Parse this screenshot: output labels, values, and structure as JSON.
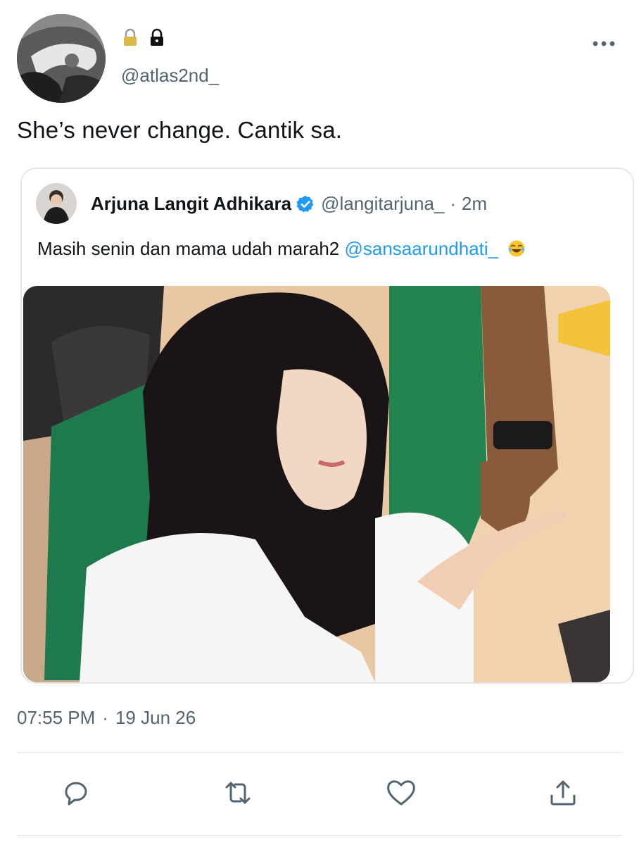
{
  "tweet": {
    "handle": "@atlas2nd_",
    "text": "She’s never change. Cantik sa.",
    "timestamp_time": "07:55 PM",
    "timestamp_sep": "·",
    "timestamp_date": "19 Jun 26"
  },
  "quote": {
    "name": "Arjuna Langit Adhikara",
    "handle": "@langitarjuna_",
    "separator": "·",
    "time": "2m",
    "text": "Masih senin dan mama udah marah2",
    "mention": "@sansaarundhati_",
    "emoji": "face-with-tears-of-joy-icon"
  },
  "icons": {
    "header": [
      "lock-icon",
      "lock-icon",
      "more-icon"
    ],
    "actions": [
      "reply-icon",
      "retweet-icon",
      "like-icon",
      "share-icon"
    ]
  },
  "colors": {
    "accent": "#1d9bf0",
    "secondary_text": "#536471",
    "primary_text": "#0f1419",
    "border": "#e3e7ea"
  }
}
